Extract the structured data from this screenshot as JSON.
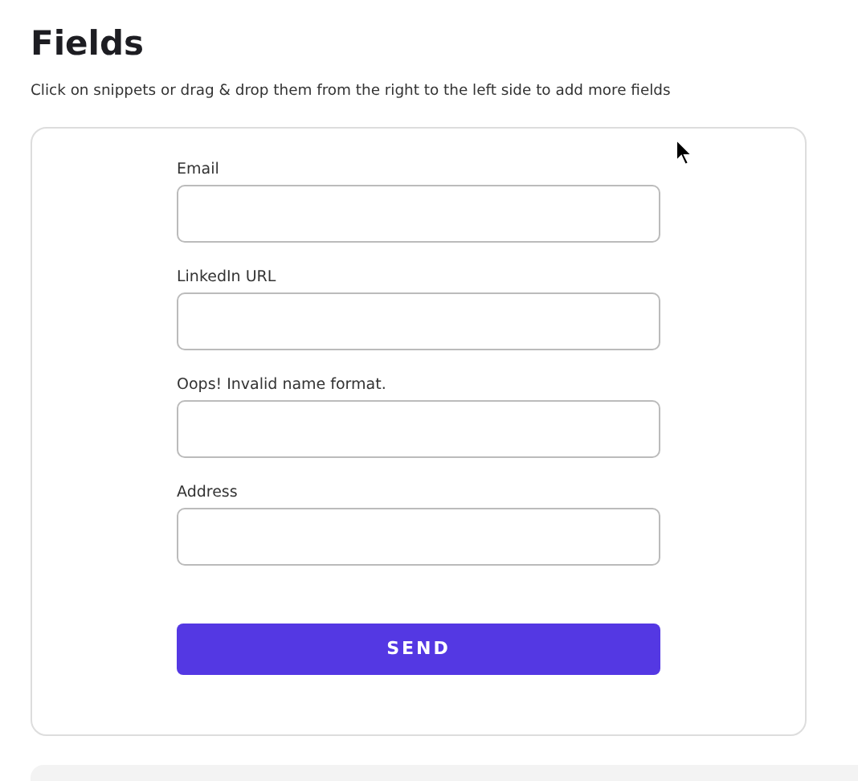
{
  "page": {
    "title": "Fields",
    "subtitle": "Click on snippets or drag & drop them from the right to the left side to add more fields"
  },
  "form": {
    "fields": [
      {
        "label": "Email"
      },
      {
        "label": "LinkedIn URL"
      },
      {
        "label": "Oops! Invalid name format."
      },
      {
        "label": "Address"
      }
    ],
    "submit": "SEND"
  }
}
